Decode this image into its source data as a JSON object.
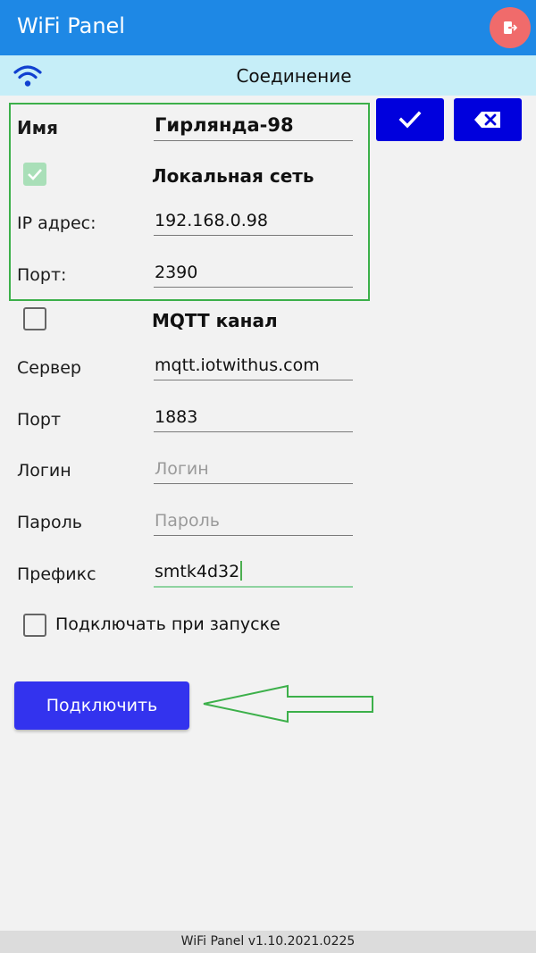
{
  "app": {
    "title": "WiFi Panel",
    "screen_title": "Соединение",
    "version": "WiFi Panel v1.10.2021.0225"
  },
  "colors": {
    "appbar": "#1e88e5",
    "subbar": "#c6eef8",
    "exit_button": "#f06b6b",
    "action_button": "#0000dd",
    "connect_button": "#3333ee",
    "highlight": "#3cb04a"
  },
  "icons": {
    "exit": "exit-icon",
    "wifi": "wifi-icon",
    "confirm": "check-icon",
    "clear": "backspace-icon"
  },
  "form": {
    "name": {
      "label": "Имя",
      "value": "Гирлянда-98"
    },
    "local_network": {
      "label": "Локальная сеть",
      "checked": true
    },
    "ip": {
      "label": "IP адрес:",
      "value": "192.168.0.98"
    },
    "port": {
      "label": "Порт:",
      "value": "2390"
    },
    "mqtt": {
      "label": "MQTT канал",
      "checked": false
    },
    "server": {
      "label": "Сервер",
      "value": "mqtt.iotwithus.com"
    },
    "mqtt_port": {
      "label": "Порт",
      "value": "1883"
    },
    "login": {
      "label": "Логин",
      "value": "",
      "placeholder": "Логин"
    },
    "password": {
      "label": "Пароль",
      "value": "",
      "placeholder": "Пароль"
    },
    "prefix": {
      "label": "Префикс",
      "value": "smtk4d32"
    },
    "autoconnect": {
      "label": "Подключать при запуске",
      "checked": false
    }
  },
  "buttons": {
    "connect": "Подключить"
  }
}
